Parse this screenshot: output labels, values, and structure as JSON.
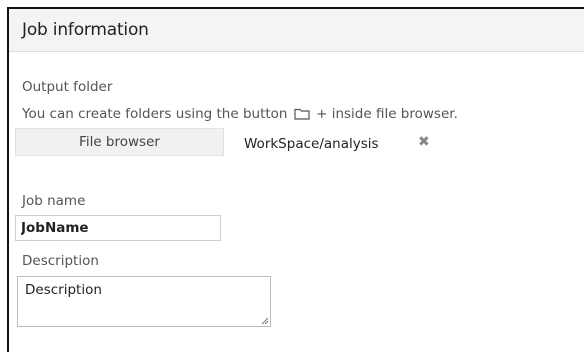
{
  "panel": {
    "title": "Job information"
  },
  "output_folder": {
    "label": "Output folder",
    "hint_before": "You can create folders using the button",
    "hint_after": "+ inside file browser.",
    "file_browser_label": "File browser",
    "selected_path": "WorkSpace/analysis",
    "clear_icon": "times-icon"
  },
  "job_name": {
    "label": "Job name",
    "value": "JobName"
  },
  "description": {
    "label": "Description",
    "value": "Description"
  }
}
